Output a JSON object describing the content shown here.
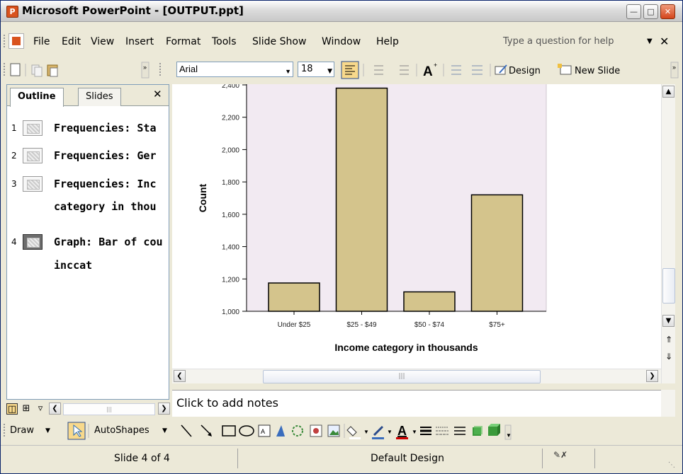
{
  "window": {
    "title": "Microsoft PowerPoint - [OUTPUT.ppt]"
  },
  "menu": {
    "items": [
      "File",
      "Edit",
      "View",
      "Insert",
      "Format",
      "Tools",
      "Slide Show",
      "Window",
      "Help"
    ],
    "help_placeholder": "Type a question for help"
  },
  "formatting": {
    "font": "Arial",
    "size": "18",
    "design_label": "Design",
    "new_slide_label": "New Slide"
  },
  "left_pane": {
    "tabs": [
      "Outline",
      "Slides"
    ],
    "outline": [
      {
        "num": "1",
        "text": "Frequencies: Sta"
      },
      {
        "num": "2",
        "text": "Frequencies: Ger"
      },
      {
        "num": "3",
        "text": "Frequencies: Inc",
        "text2": "category in thou"
      },
      {
        "num": "4",
        "text": "Graph: Bar of cou",
        "text2": "inccat"
      }
    ]
  },
  "notes": {
    "placeholder": "Click to add notes"
  },
  "draw_toolbar": {
    "draw_label": "Draw",
    "autoshapes_label": "AutoShapes"
  },
  "status": {
    "slide": "Slide 4 of 4",
    "design": "Default Design"
  },
  "colors": {
    "bar_fill": "#d4c48c",
    "plot_bg": "#f2eaf2",
    "accent": "#d9531e"
  },
  "chart_data": {
    "type": "bar",
    "categories": [
      "Under $25",
      "$25 - $49",
      "$50 - $74",
      "$75+"
    ],
    "values": [
      1175,
      2380,
      1120,
      1720
    ],
    "xlabel": "Income category in thousands",
    "ylabel": "Count",
    "ylim": [
      1000,
      2400
    ],
    "yticks": [
      "1,000",
      "1,200",
      "1,400",
      "1,600",
      "1,800",
      "2,000",
      "2,200",
      "2,400"
    ],
    "ytick_values": [
      1000,
      1200,
      1400,
      1600,
      1800,
      2000,
      2200,
      2400
    ],
    "grid": false
  }
}
